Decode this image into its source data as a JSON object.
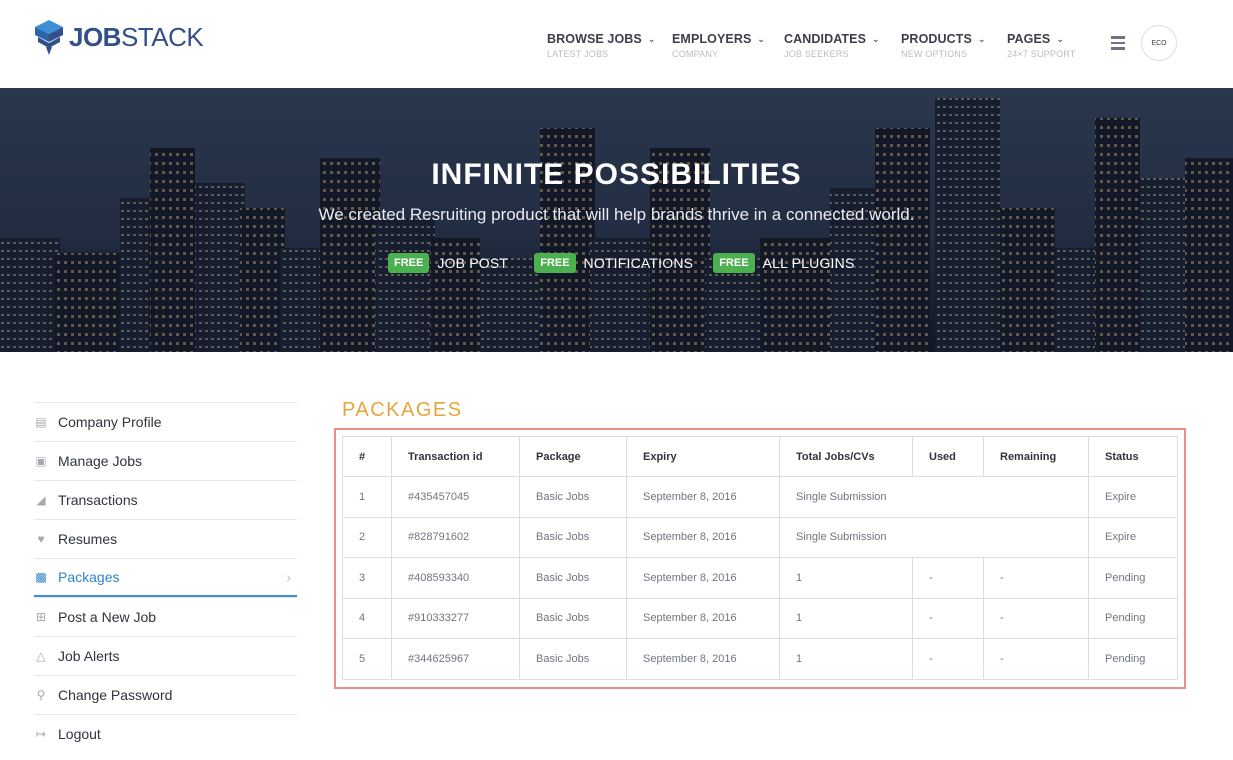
{
  "brand": {
    "logo_bold": "JOB",
    "logo_light": "STACK",
    "color": "#34508a"
  },
  "nav": [
    {
      "label": "BROWSE JOBS",
      "sub": "LATEST JOBS"
    },
    {
      "label": "EMPLOYERS",
      "sub": "COMPANY"
    },
    {
      "label": "CANDIDATES",
      "sub": "JOB SEEKERS"
    },
    {
      "label": "PRODUCTS",
      "sub": "NEW OPTIONS"
    },
    {
      "label": "PAGES",
      "sub": "24×7 SUPPORT"
    }
  ],
  "avatar_text": "ECO",
  "hero": {
    "title": "INFINITE  POSSIBILITIES",
    "subtitle": "We created Resruiting product that will help brands thrive in a connected world.",
    "badge": "FREE",
    "features": [
      "JOB POST",
      "NOTIFICATIONS",
      "ALL PLUGINS"
    ]
  },
  "sidebar": [
    {
      "label": "Company Profile",
      "icon": "profile-icon"
    },
    {
      "label": "Manage Jobs",
      "icon": "briefcase-icon"
    },
    {
      "label": "Transactions",
      "icon": "chart-icon"
    },
    {
      "label": "Resumes",
      "icon": "heart-icon"
    },
    {
      "label": "Packages",
      "icon": "package-icon",
      "active": true
    },
    {
      "label": "Post a New Job",
      "icon": "plus-square-icon"
    },
    {
      "label": "Job Alerts",
      "icon": "bell-icon"
    },
    {
      "label": "Change Password",
      "icon": "key-icon"
    },
    {
      "label": "Logout",
      "icon": "logout-icon"
    }
  ],
  "packages": {
    "title": "PACKAGES",
    "columns": [
      "#",
      "Transaction id",
      "Package",
      "Expiry",
      "Total Jobs/CVs",
      "Used",
      "Remaining",
      "Status"
    ],
    "rows": [
      {
        "n": "1",
        "tx": "#435457045",
        "pkg": "Basic Jobs",
        "expiry": "September 8, 2016",
        "total": "Single Submission",
        "used": "",
        "remaining": "",
        "status": "Expire"
      },
      {
        "n": "2",
        "tx": "#828791602",
        "pkg": "Basic Jobs",
        "expiry": "September 8, 2016",
        "total": "Single Submission",
        "used": "",
        "remaining": "",
        "status": "Expire"
      },
      {
        "n": "3",
        "tx": "#408593340",
        "pkg": "Basic Jobs",
        "expiry": "September 8, 2016",
        "total": "1",
        "used": "-",
        "remaining": "-",
        "status": "Pending"
      },
      {
        "n": "4",
        "tx": "#910333277",
        "pkg": "Basic Jobs",
        "expiry": "September 8, 2016",
        "total": "1",
        "used": "-",
        "remaining": "-",
        "status": "Pending"
      },
      {
        "n": "5",
        "tx": "#344625967",
        "pkg": "Basic Jobs",
        "expiry": "September 8, 2016",
        "total": "1",
        "used": "-",
        "remaining": "-",
        "status": "Pending"
      }
    ]
  },
  "colors": {
    "accent": "#2e87c8",
    "title_orange": "#e8a53a",
    "badge_green": "#4caf50",
    "highlight_frame": "#ef8c8c"
  }
}
